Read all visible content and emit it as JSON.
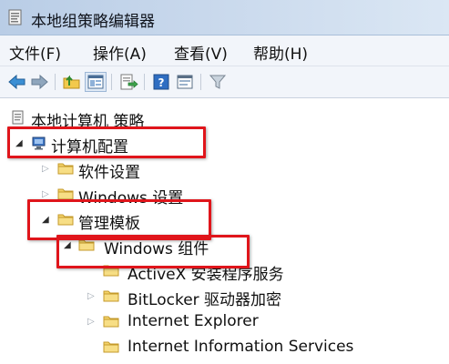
{
  "window": {
    "title": "本地组策略编辑器"
  },
  "menu": [
    "文件(F)",
    "操作(A)",
    "查看(V)",
    "帮助(H)"
  ],
  "toolbar": [
    "back-icon",
    "forward-icon",
    "up-folder-icon",
    "show-hide-tree-icon",
    "export-list-icon",
    "help-icon",
    "properties-icon",
    "filter-icon"
  ],
  "tree": {
    "root": "本地计算机 策略",
    "computer_config": "计算机配置",
    "software_settings": "软件设置",
    "windows_settings": "Windows 设置",
    "admin_templates": "管理模板",
    "windows_components": "Windows 组件",
    "activex": "ActiveX 安装程序服务",
    "bitlocker": "BitLocker 驱动器加密",
    "ie": "Internet Explorer",
    "iis": "Internet Information Services"
  },
  "highlight_color": "#e0151b"
}
